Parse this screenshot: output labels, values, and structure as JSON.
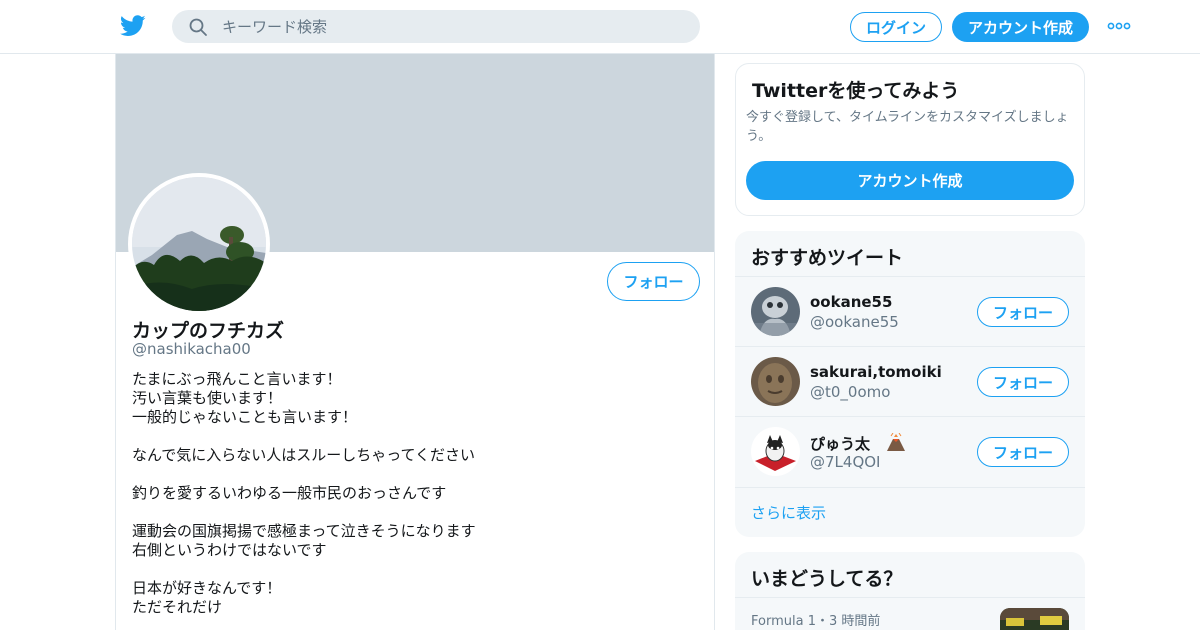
{
  "header": {
    "search_placeholder": "キーワード検索",
    "login_label": "ログイン",
    "signup_label": "アカウント作成"
  },
  "profile": {
    "follow_label": "フォロー",
    "name": "カップのフチカズ",
    "handle": "@nashikacha00",
    "bio_lines": [
      "たまにぶっ飛んこと言います！",
      "汚い言葉も使います！",
      "一般的じゃないことも言います！",
      "",
      "なんで気に入らない人はスルーしちゃってください",
      "",
      "釣りを愛するいわゆる一般市民のおっさんです",
      "",
      "運動会の国旗掲揚で感極まって泣きそうになります",
      "右側というわけではないです",
      "",
      "日本が好きなんです！",
      "ただそれだけ"
    ]
  },
  "signup_card": {
    "title": "Twitterを使ってみよう",
    "subtitle": "今すぐ登録して、タイムラインをカスタマイズしましょう。",
    "button_label": "アカウント作成"
  },
  "recommended": {
    "title": "おすすめツイート",
    "follow_label": "フォロー",
    "users": [
      {
        "name": "ookane55",
        "handle": "@ookane55"
      },
      {
        "name": "sakurai,tomoiki",
        "handle": "@t0_0omo"
      },
      {
        "name": "ぴゅう太",
        "handle": "@7L4QOI"
      }
    ],
    "more_label": "さらに表示"
  },
  "trends": {
    "title": "いまどうしてる？",
    "item_meta": "Formula 1・3 時間前"
  },
  "colors": {
    "accent": "#1da1f2",
    "banner": "#ccd6dd",
    "muted_text": "#657786",
    "card_bg": "#f5f8fa"
  }
}
